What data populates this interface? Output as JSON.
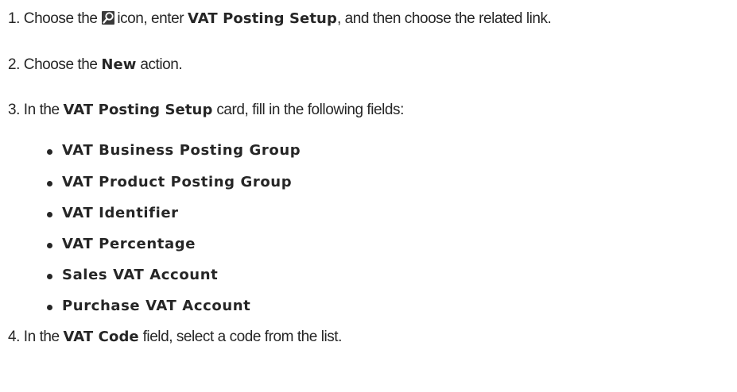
{
  "steps": [
    {
      "num": "1.",
      "before_icon": "Choose the",
      "icon": "search-icon",
      "after_icon": "icon, enter",
      "bold": "VAT Posting Setup",
      "after_bold": ", and then choose the related link."
    },
    {
      "num": "2.",
      "before": "Choose the",
      "bold": "New",
      "after": "action."
    },
    {
      "num": "3.",
      "before": "In the",
      "bold": "VAT Posting Setup",
      "after": "card, fill in the following fields:"
    },
    {
      "num": "4.",
      "before": "In the",
      "bold": "VAT Code",
      "after": "field, select a code from the list."
    }
  ],
  "fields": [
    "VAT Business Posting Group",
    "VAT Product Posting Group",
    "VAT Identifier",
    "VAT Percentage",
    "Sales VAT Account",
    "Purchase VAT Account"
  ]
}
